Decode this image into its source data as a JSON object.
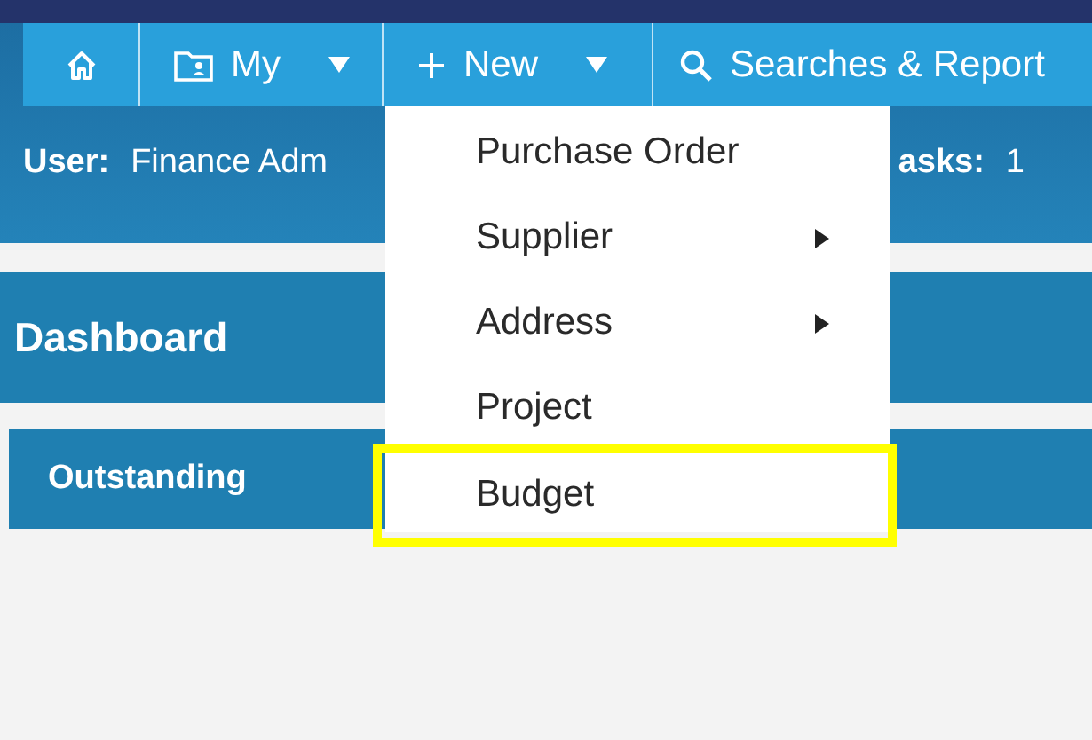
{
  "nav": [
    {
      "has_menu": false
    },
    {
      "label": "My",
      "has_menu": true
    },
    {
      "label": "New",
      "has_menu": true
    },
    {
      "label": "Searches & Report",
      "has_menu": false
    }
  ],
  "info": {
    "user_label": "User:",
    "user_value": "Finance Adm",
    "tasks_label": "asks:",
    "tasks_value": "1"
  },
  "dashboard": {
    "title": "Dashboard"
  },
  "panel": {
    "title": "Outstanding"
  },
  "menu": [
    {
      "label": "Purchase Order",
      "has_submenu": false,
      "highlighted": false
    },
    {
      "label": "Supplier",
      "has_submenu": true,
      "highlighted": false
    },
    {
      "label": "Address",
      "has_submenu": true,
      "highlighted": false
    },
    {
      "label": "Project",
      "has_submenu": false,
      "highlighted": false
    },
    {
      "label": "Budget",
      "has_submenu": false,
      "highlighted": true
    }
  ]
}
